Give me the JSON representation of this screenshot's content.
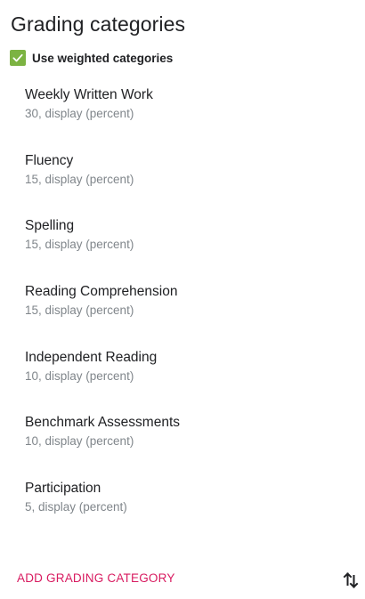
{
  "header": {
    "title": "Grading categories"
  },
  "weighted": {
    "label": "Use weighted categories",
    "checked": true,
    "check_color": "#7cb342"
  },
  "categories": [
    {
      "name": "Weekly Written Work",
      "detail": "30, display (percent)"
    },
    {
      "name": "Fluency",
      "detail": "15, display (percent)"
    },
    {
      "name": "Spelling",
      "detail": "15, display (percent)"
    },
    {
      "name": "Reading Comprehension",
      "detail": "15, display (percent)"
    },
    {
      "name": "Independent Reading",
      "detail": "10, display (percent)"
    },
    {
      "name": "Benchmark Assessments",
      "detail": "10, display (percent)"
    },
    {
      "name": "Participation",
      "detail": "5, display (percent)"
    }
  ],
  "footer": {
    "add_label": "ADD GRADING CATEGORY",
    "add_color": "#d81b60",
    "reorder_icon": "swap-vert-icon"
  }
}
